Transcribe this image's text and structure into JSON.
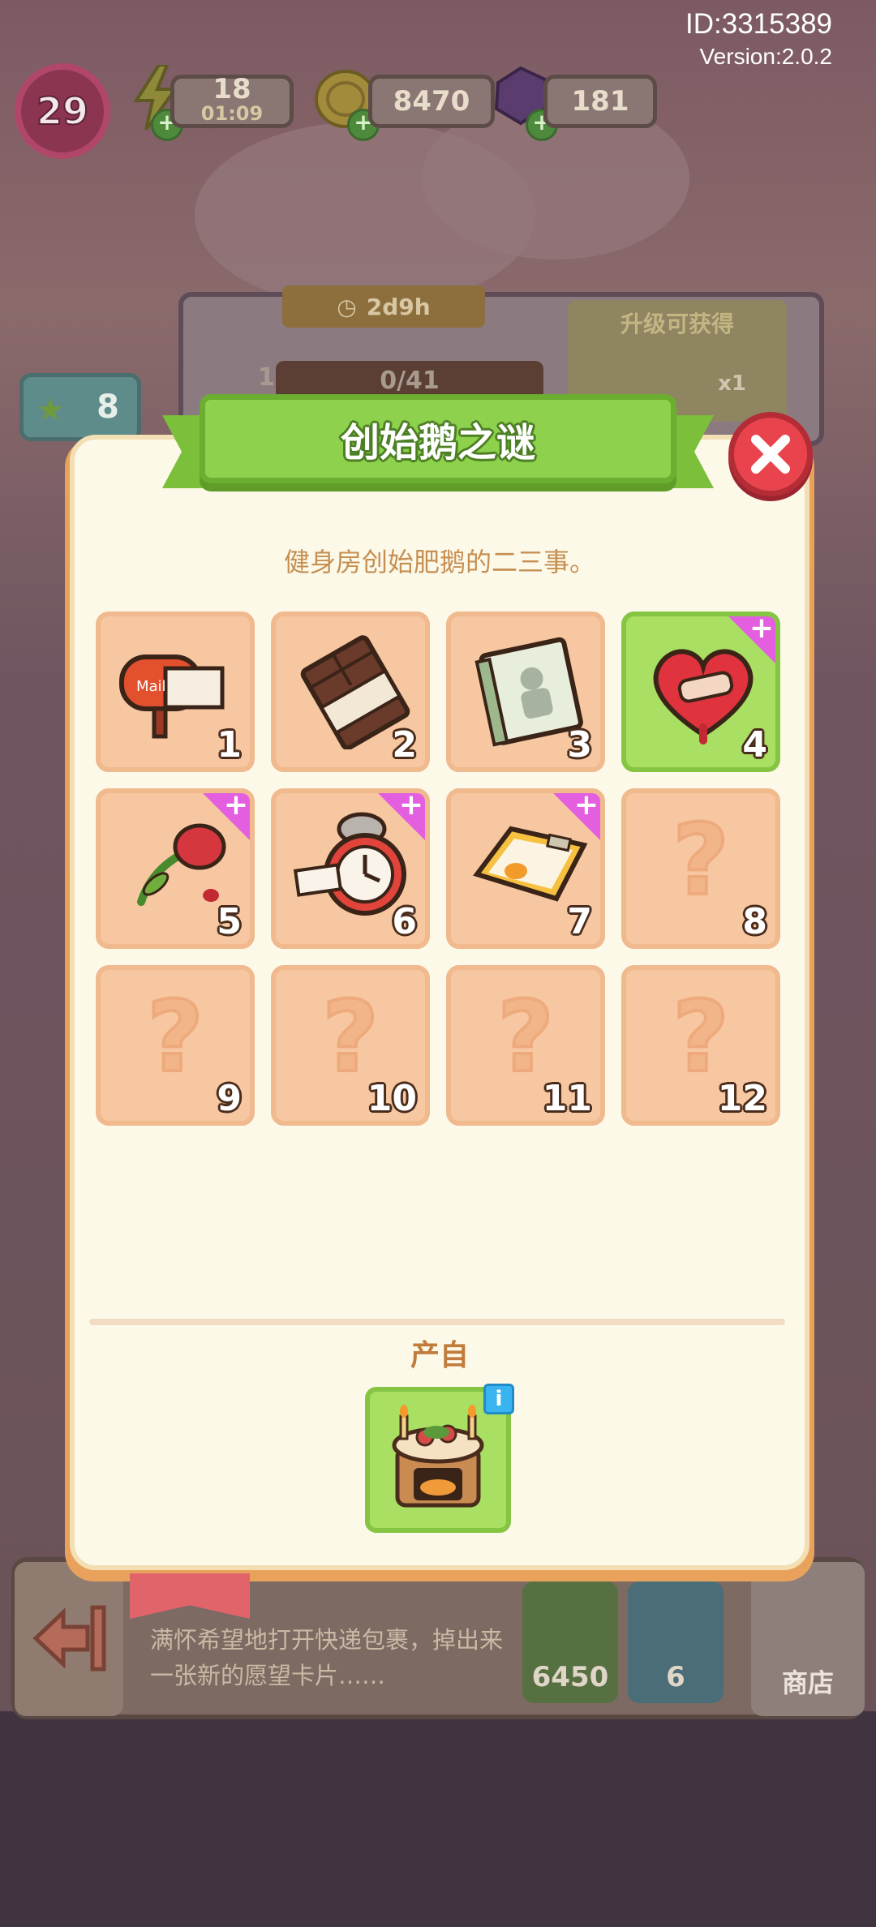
{
  "hud": {
    "player_level": "29",
    "energy": "18",
    "energy_timer": "01:09",
    "coins": "8470",
    "gems": "181",
    "player_id": "ID:3315389",
    "version": "Version:2.0.2"
  },
  "event_panel": {
    "timer": "2d9h",
    "progress": "0/41",
    "upgrade_label": "升级可获得",
    "reward_count": "x1",
    "goose_count": "8",
    "panel_level": "1"
  },
  "bottom_bar": {
    "description": "满怀希望地打开快递包裹，掉出来一张新的愿望卡片……",
    "gem_cost": "6450",
    "coin_cost": "6",
    "shop_label": "商店"
  },
  "modal": {
    "title": "创始鹅之谜",
    "subtitle": "健身房创始肥鹅的二三事。",
    "source_label": "产自",
    "info_icon_text": "i"
  },
  "collection": [
    {
      "number": "1",
      "item": "mailbox-icon",
      "unlocked": true,
      "has_plus": false,
      "highlight": false
    },
    {
      "number": "2",
      "item": "chocolate-bar-icon",
      "unlocked": true,
      "has_plus": false,
      "highlight": false
    },
    {
      "number": "3",
      "item": "notebook-icon",
      "unlocked": true,
      "has_plus": false,
      "highlight": false
    },
    {
      "number": "4",
      "item": "bandaged-heart-icon",
      "unlocked": true,
      "has_plus": true,
      "highlight": true
    },
    {
      "number": "5",
      "item": "wilted-rose-icon",
      "unlocked": true,
      "has_plus": true,
      "highlight": false
    },
    {
      "number": "6",
      "item": "alarm-clock-icon",
      "unlocked": true,
      "has_plus": true,
      "highlight": false
    },
    {
      "number": "7",
      "item": "goose-scale-icon",
      "unlocked": true,
      "has_plus": true,
      "highlight": false
    },
    {
      "number": "8",
      "item": "unknown-icon",
      "unlocked": false,
      "has_plus": false,
      "highlight": false
    },
    {
      "number": "9",
      "item": "unknown-icon",
      "unlocked": false,
      "has_plus": false,
      "highlight": false
    },
    {
      "number": "10",
      "item": "unknown-icon",
      "unlocked": false,
      "has_plus": false,
      "highlight": false
    },
    {
      "number": "11",
      "item": "unknown-icon",
      "unlocked": false,
      "has_plus": false,
      "highlight": false
    },
    {
      "number": "12",
      "item": "unknown-icon",
      "unlocked": false,
      "has_plus": false,
      "highlight": false
    }
  ],
  "colors": {
    "highlight_green": "#a9df62",
    "cell_peach": "#f6c7a0",
    "plus_magenta": "#e35fe0",
    "close_red": "#e9444d",
    "title_green": "#8dd14c"
  }
}
